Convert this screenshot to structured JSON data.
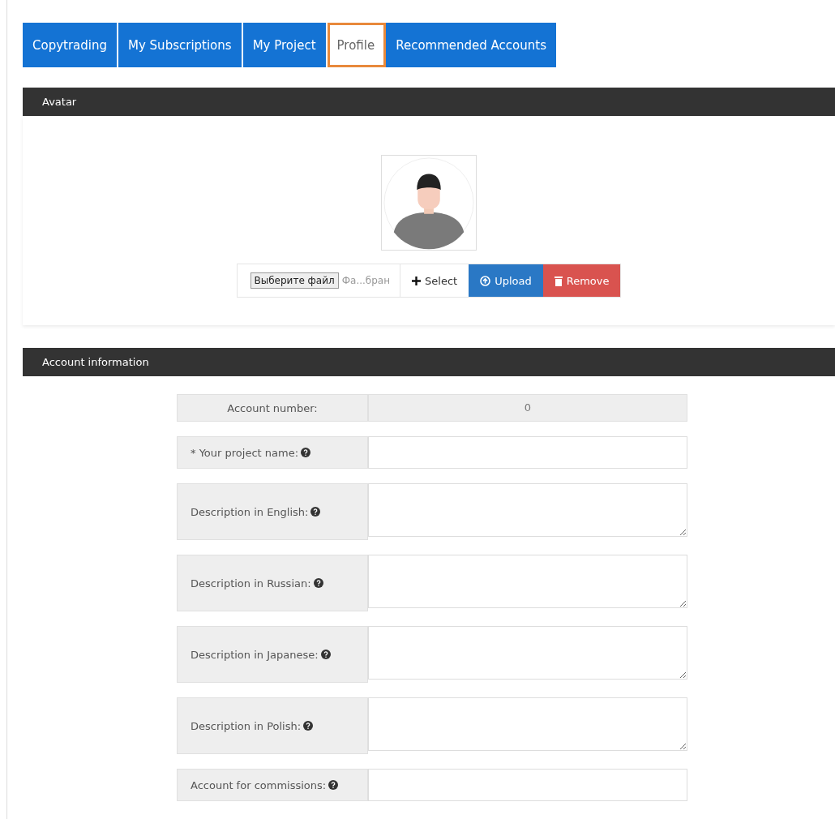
{
  "tabs": [
    {
      "label": "Copytrading",
      "selected": false,
      "highlighted": false
    },
    {
      "label": "My Subscriptions",
      "selected": false,
      "highlighted": false
    },
    {
      "label": "My Project",
      "selected": false,
      "highlighted": false
    },
    {
      "label": "Profile",
      "selected": true,
      "highlighted": true
    },
    {
      "label": "Recommended Accounts",
      "selected": false,
      "highlighted": false
    }
  ],
  "avatar_section": {
    "title": "Avatar",
    "file_button": "Выберите файл",
    "file_name": "Фа...бран",
    "buttons": [
      {
        "label": "Select",
        "kind": "select"
      },
      {
        "label": "Upload",
        "kind": "upload"
      },
      {
        "label": "Remove",
        "kind": "remove"
      }
    ]
  },
  "account_section": {
    "title": "Account information",
    "fields": [
      {
        "label": "Account number:",
        "kind": "readonly",
        "value": "0",
        "help": false
      },
      {
        "label": "* Your project name:",
        "kind": "input",
        "help": true
      },
      {
        "label": "Description in English:",
        "kind": "textarea",
        "help": true
      },
      {
        "label": "Description in Russian:",
        "kind": "textarea",
        "help": true
      },
      {
        "label": "Description in Japanese:",
        "kind": "textarea",
        "help": true
      },
      {
        "label": "Description in Polish:",
        "kind": "textarea",
        "help": true
      },
      {
        "label": "Account for commissions:",
        "kind": "input",
        "help": true
      }
    ]
  }
}
